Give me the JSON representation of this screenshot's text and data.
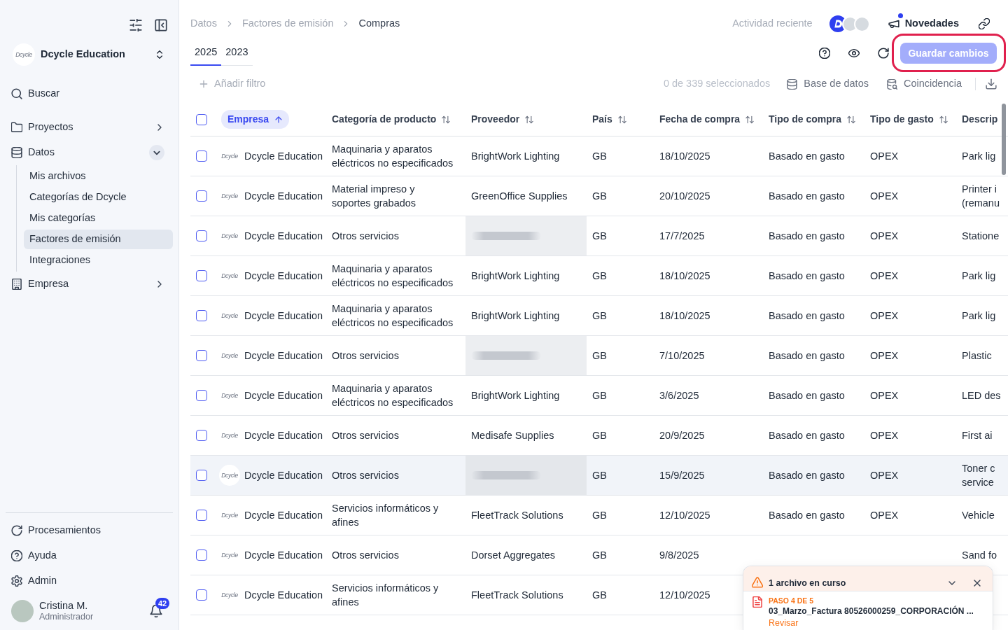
{
  "sidebar": {
    "org": {
      "logo": "Dcycle",
      "name": "Dcycle Education"
    },
    "search": "Buscar",
    "nav": [
      {
        "label": "Proyectos",
        "expanded": false
      },
      {
        "label": "Datos",
        "expanded": true,
        "children": [
          {
            "label": "Mis archivos",
            "selected": false
          },
          {
            "label": "Categorías de Dcycle",
            "selected": false
          },
          {
            "label": "Mis categorías",
            "selected": false
          },
          {
            "label": "Factores de emisión",
            "selected": true
          },
          {
            "label": "Integraciones",
            "selected": false
          }
        ]
      },
      {
        "label": "Empresa",
        "expanded": false
      }
    ],
    "footer_nav": [
      {
        "label": "Procesamientos"
      },
      {
        "label": "Ayuda"
      },
      {
        "label": "Admin"
      }
    ],
    "user": {
      "name": "Cristina M.",
      "role": "Administrador",
      "notifications": "42"
    }
  },
  "header": {
    "breadcrumb": [
      "Datos",
      "Factores de emisión",
      "Compras"
    ],
    "recent_activity": "Actividad reciente",
    "news": {
      "label": "Novedades",
      "unread": true
    }
  },
  "year_tabs": [
    {
      "label": "2025",
      "selected": true
    },
    {
      "label": "2023",
      "selected": false
    }
  ],
  "save_button": {
    "label": "Guardar cambios",
    "disabled": true,
    "highlighted": true
  },
  "toolbar": {
    "add_filter": "Añadir filtro",
    "selection_count": "0 de 339 seleccionados",
    "actions": [
      "Base de datos",
      "Coincidencia"
    ]
  },
  "table": {
    "all_checked": false,
    "columns": [
      {
        "label": "Empresa",
        "sorted": true
      },
      {
        "label": "Categoría de producto",
        "sorted": false
      },
      {
        "label": "Proveedor",
        "sorted": false
      },
      {
        "label": "País",
        "sorted": false
      },
      {
        "label": "Fecha de compra",
        "sorted": false
      },
      {
        "label": "Tipo de compra",
        "sorted": false
      },
      {
        "label": "Tipo de gasto",
        "sorted": false
      },
      {
        "label": "Descrip"
      }
    ],
    "rows": [
      {
        "checked": false,
        "hovered": false,
        "logo": "Dcycle",
        "company": "Dcycle Education",
        "category": "Maquinaria y aparatos eléctricos no especificados",
        "supplier": "BrightWork Lighting",
        "supplier_blurred": false,
        "country": "GB",
        "date": "18/10/2025",
        "purchase_type": "Basado en gasto",
        "expense_type": "OPEX",
        "description": "Park lig"
      },
      {
        "checked": false,
        "hovered": false,
        "logo": "Dcycle",
        "company": "Dcycle Education",
        "category": "Material impreso y soportes grabados",
        "supplier": "GreenOffice Supplies",
        "supplier_blurred": false,
        "country": "GB",
        "date": "20/10/2025",
        "purchase_type": "Basado en gasto",
        "expense_type": "OPEX",
        "description": "Printer i\n(remanu"
      },
      {
        "checked": false,
        "hovered": false,
        "logo": "Dcycle",
        "company": "Dcycle Education",
        "category": "Otros servicios",
        "supplier_blurred": true,
        "country": "GB",
        "date": "17/7/2025",
        "purchase_type": "Basado en gasto",
        "expense_type": "OPEX",
        "description": "Statione"
      },
      {
        "checked": false,
        "hovered": false,
        "logo": "Dcycle",
        "company": "Dcycle Education",
        "category": "Maquinaria y aparatos eléctricos no especificados",
        "supplier": "BrightWork Lighting",
        "supplier_blurred": false,
        "country": "GB",
        "date": "18/10/2025",
        "purchase_type": "Basado en gasto",
        "expense_type": "OPEX",
        "description": "Park lig"
      },
      {
        "checked": false,
        "hovered": false,
        "logo": "Dcycle",
        "company": "Dcycle Education",
        "category": "Maquinaria y aparatos eléctricos no especificados",
        "supplier": "BrightWork Lighting",
        "supplier_blurred": false,
        "country": "GB",
        "date": "18/10/2025",
        "purchase_type": "Basado en gasto",
        "expense_type": "OPEX",
        "description": "Park lig"
      },
      {
        "checked": false,
        "hovered": false,
        "logo": "Dcycle",
        "company": "Dcycle Education",
        "category": "Otros servicios",
        "supplier_blurred": true,
        "country": "GB",
        "date": "7/10/2025",
        "purchase_type": "Basado en gasto",
        "expense_type": "OPEX",
        "description": "Plastic"
      },
      {
        "checked": false,
        "hovered": false,
        "logo": "Dcycle",
        "company": "Dcycle Education",
        "category": "Maquinaria y aparatos eléctricos no especificados",
        "supplier": "BrightWork Lighting",
        "supplier_blurred": false,
        "country": "GB",
        "date": "3/6/2025",
        "purchase_type": "Basado en gasto",
        "expense_type": "OPEX",
        "description": "LED des"
      },
      {
        "checked": false,
        "hovered": false,
        "logo": "Dcycle",
        "company": "Dcycle Education",
        "category": "Otros servicios",
        "supplier": "Medisafe Supplies",
        "supplier_blurred": false,
        "country": "GB",
        "date": "20/9/2025",
        "purchase_type": "Basado en gasto",
        "expense_type": "OPEX",
        "description": "First ai"
      },
      {
        "checked": false,
        "hovered": true,
        "logo": "Dcycle",
        "company": "Dcycle Education",
        "category": "Otros servicios",
        "supplier_blurred": true,
        "country": "GB",
        "date": "15/9/2025",
        "purchase_type": "Basado en gasto",
        "expense_type": "OPEX",
        "description": "Toner c\nservice"
      },
      {
        "checked": false,
        "hovered": false,
        "logo": "Dcycle",
        "company": "Dcycle Education",
        "category": "Servicios informáticos y afines",
        "supplier": "FleetTrack Solutions",
        "supplier_blurred": false,
        "country": "GB",
        "date": "12/10/2025",
        "purchase_type": "Basado en gasto",
        "expense_type": "OPEX",
        "description": "Vehicle"
      },
      {
        "checked": false,
        "hovered": false,
        "logo": "Dcycle",
        "company": "Dcycle Education",
        "category": "Otros servicios",
        "supplier": "Dorset Aggregates",
        "supplier_blurred": false,
        "country": "GB",
        "date": "9/8/2025",
        "description": "Sand fo"
      },
      {
        "checked": false,
        "hovered": false,
        "logo": "Dcycle",
        "company": "Dcycle Education",
        "category": "Servicios informáticos y afines",
        "supplier": "FleetTrack Solutions",
        "supplier_blurred": false,
        "country": "GB",
        "date": "12/10/2025"
      }
    ]
  },
  "upload_panel": {
    "title": "1 archivo en curso",
    "files": [
      {
        "step": "PASO 4 DE 5",
        "name": "03_Marzo_Factura 80526000259_CORPORACIÓN ...",
        "action": "Revisar"
      }
    ]
  }
}
